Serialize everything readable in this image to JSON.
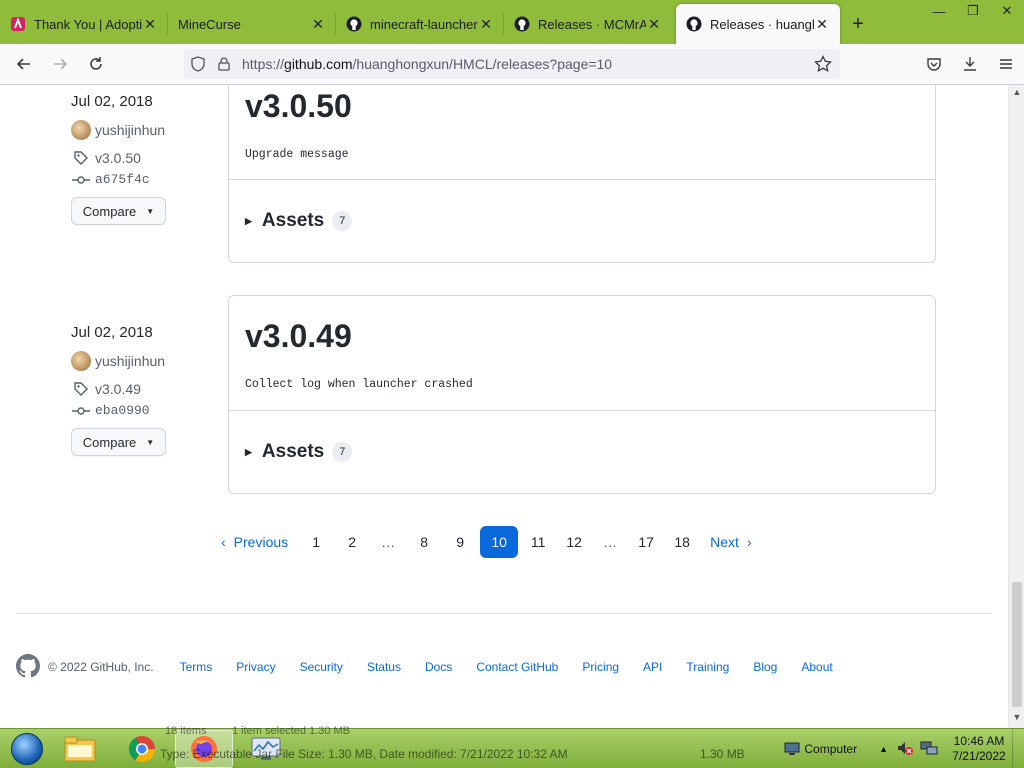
{
  "browser": {
    "tabs": [
      {
        "title": "Thank You | Adoptium",
        "icon": "adoptium-icon",
        "active": false
      },
      {
        "title": "MineCurse",
        "icon": "",
        "active": false
      },
      {
        "title": "minecraft-launcher ·",
        "icon": "github-icon",
        "active": false
      },
      {
        "title": "Releases · MCMrARM",
        "icon": "github-icon",
        "active": false
      },
      {
        "title": "Releases · huanghongxun",
        "icon": "github-icon",
        "active": true
      }
    ],
    "url_prefix": "https://",
    "url_host": "github.com",
    "url_path": "/huanghongxun/HMCL/releases?page=10"
  },
  "releases": [
    {
      "date": "Jul 02, 2018",
      "author": "yushijinhun",
      "tag": "v3.0.50",
      "commit": "a675f4c",
      "compare_label": "Compare",
      "version": "v3.0.50",
      "message": "Upgrade message",
      "assets_label": "Assets",
      "assets_count": "7"
    },
    {
      "date": "Jul 02, 2018",
      "author": "yushijinhun",
      "tag": "v3.0.49",
      "commit": "eba0990",
      "compare_label": "Compare",
      "version": "v3.0.49",
      "message": "Collect log when launcher crashed",
      "assets_label": "Assets",
      "assets_count": "7"
    }
  ],
  "pagination": {
    "previous": "Previous",
    "next": "Next",
    "pages": [
      "1",
      "2",
      "…",
      "8",
      "9",
      "10",
      "11",
      "12",
      "…",
      "17",
      "18"
    ],
    "current": "10"
  },
  "footer": {
    "copyright": "© 2022 GitHub, Inc.",
    "links": [
      "Terms",
      "Privacy",
      "Security",
      "Status",
      "Docs",
      "Contact GitHub",
      "Pricing",
      "API",
      "Training",
      "Blog",
      "About"
    ]
  },
  "taskbar": {
    "ghost_top_left": "18 items",
    "ghost_top_mid": "1 item selected  1.30 MB",
    "ghost_status": "Type: Executable Jar File Size: 1.30 MB, Date modified: 7/21/2022 10:32 AM",
    "ghost_size": "1.30 MB",
    "computer_label": "Computer",
    "time": "10:46 AM",
    "date": "7/21/2022"
  },
  "colors": {
    "accent": "#0969da",
    "tabstrip": "#8fbd3b"
  }
}
